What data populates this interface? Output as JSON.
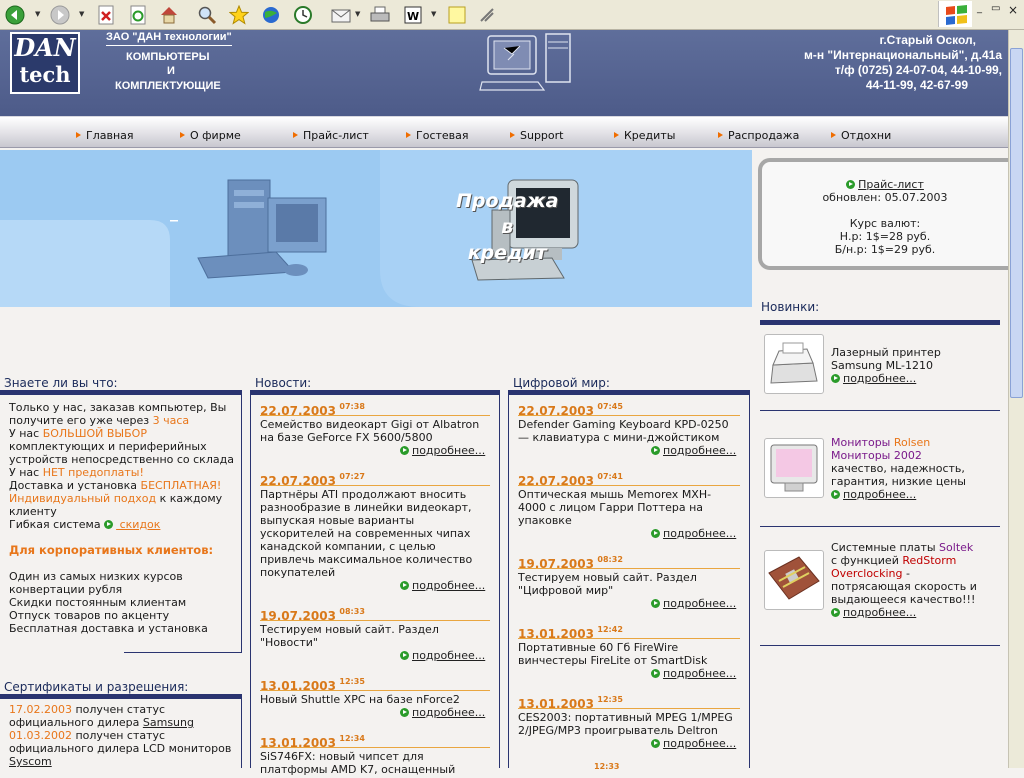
{
  "browser": {
    "toolbar_icons": [
      "back-icon",
      "forward-icon",
      "stop-icon",
      "refresh-icon",
      "home-icon",
      "search-icon",
      "favorites-icon",
      "media-icon",
      "history-icon",
      "mail-icon",
      "print-icon",
      "edit-icon",
      "discuss-icon",
      "messenger-icon"
    ],
    "window_buttons": [
      "_",
      "▭",
      "×"
    ]
  },
  "header": {
    "logo_line1": "DAN",
    "logo_line2": "tech",
    "company": "ЗАО \"ДАН технологии\"",
    "tagline1": "КОМПЬЮТЕРЫ",
    "tagline2": "И",
    "tagline3": "КОМПЛЕКТУЮЩИЕ",
    "addr1": "г.Старый Оскол,",
    "addr2": "м-н \"Интернациональный\", д.41а",
    "addr3": "т/ф  (0725) 24-07-04, 44-10-99,",
    "addr4": "44-11-99, 42-67-99"
  },
  "nav": [
    "Главная",
    "О фирме",
    "Прайс-лист",
    "Гостевая",
    "Support",
    "Кредиты",
    "Распродажа",
    "Отдохни"
  ],
  "banner": {
    "promo1": "Продажа",
    "promo2": "в",
    "promo3": "кредит"
  },
  "pricebox": {
    "link": "Прайс-лист",
    "updated": "обновлен: 05.07.2003",
    "rates_title": "Курс валют:",
    "rate1": "Н.р: 1$=28 руб.",
    "rate2": "Б/н.р: 1$=29 руб."
  },
  "know": {
    "title": "Знаете ли вы что:",
    "l1": "Только у нас, заказав компьютер, Вы",
    "l2a": "получите его уже через ",
    "l2b": "3 часа",
    "l3a": "У нас ",
    "l3b": "БОЛЬШОЙ ВЫБОР",
    "l4": "комплектующих и периферийных",
    "l5": "устройств непосредственно со склада",
    "l6a": "У нас ",
    "l6b": "НЕТ предоплаты!",
    "l7a": "Доставка и установка ",
    "l7b": "БЕСПЛАТНАЯ!",
    "l8a": "Индивидуальный подход",
    "l8b": " к каждому",
    "l9": "клиенту",
    "l10a": "Гибкая система ",
    "l10b": " скидок",
    "corp_title": "Для корпоративных клиентов:",
    "corp": [
      "Один из самых низких курсов",
      "конвертации рубля",
      "Скидки постоянным клиентам",
      "Отпуск товаров по акценту",
      "Бесплатная доставка и установка"
    ]
  },
  "certs": {
    "title": "Сертификаты и разрешения:",
    "c1date": "17.02.2003",
    "c1a": " получен статус",
    "c1b": "официального дилера ",
    "c1c": "Samsung",
    "c2date": "01.03.2002",
    "c2a": " получен статус",
    "c2b": "официального дилера LCD мониторов",
    "c2c": "Syscom"
  },
  "news": {
    "title": "Новости:",
    "more": "подробнее...",
    "items": [
      {
        "date": "22.07.2003",
        "time": "07:38",
        "l1": "Семейство видеокарт Gigi от Albatron",
        "l2": "на базе GeForce FX 5600/5800"
      },
      {
        "date": "22.07.2003",
        "time": "07:27",
        "l1": "Партнёры ATI продолжают вносить",
        "l2": "разнообразие в линейки видеокарт,",
        "l3": "выпуская новые варианты",
        "l4": "ускорителей на современных чипах",
        "l5": "канадской компании, с целью",
        "l6": "привлечь максимальное количество",
        "l7": "покупателей"
      },
      {
        "date": "19.07.2003",
        "time": "08:33",
        "l1": "Тестируем новый сайт. Раздел",
        "l2": "\"Новости\""
      },
      {
        "date": "13.01.2003",
        "time": "12:35",
        "l1": "Новый Shuttle XPC на базе nForce2"
      },
      {
        "date": "13.01.2003",
        "time": "12:34",
        "l1": "SiS746FX: новый чипсет для",
        "l2": "платформы AMD K7, оснащенный"
      }
    ]
  },
  "digital": {
    "title": "Цифровой мир:",
    "more": "подробнее...",
    "items": [
      {
        "date": "22.07.2003",
        "time": "07:45",
        "l1": "Defender Gaming Keyboard KPD-0250",
        "l2": "— клавиатура с мини-джойстиком"
      },
      {
        "date": "22.07.2003",
        "time": "07:41",
        "l1": "Оптическая мышь Memorex MXH-",
        "l2": "4000 с лицом Гарри Поттера на",
        "l3": "упаковке"
      },
      {
        "date": "19.07.2003",
        "time": "08:32",
        "l1": "Тестируем новый сайт. Раздел",
        "l2": "\"Цифровой мир\""
      },
      {
        "date": "13.01.2003",
        "time": "12:42",
        "l1": "Портативные 60 Гб FireWire",
        "l2": "винчестеры FireLite от SmartDisk"
      },
      {
        "date": "13.01.2003",
        "time": "12:35",
        "l1": "CES2003: портативный MPEG 1/MPEG",
        "l2": "2/JPEG/MP3 проигрыватель Deltron"
      },
      {
        "date": "",
        "time": "12:33"
      }
    ]
  },
  "novelties": {
    "title": "Новинки:",
    "more": "подробнее...",
    "p1": {
      "l1": "Лазерный принтер",
      "l2": "Samsung ML-1210"
    },
    "p2": {
      "l1a": "Мониторы ",
      "l1b": "Rolsen",
      "l2": "Мониторы 2002",
      "l3": "качество, надежность,",
      "l4": "гарантия, низкие цены"
    },
    "p3": {
      "l1a": "Системные платы ",
      "l1b": "Soltek",
      "l2a": "с функцией ",
      "l2b": "RedStorm",
      "l3a": "Overclocking",
      "l3b": " -",
      "l4": "потрясающая скорость и",
      "l5": "выдающееся качество!!!"
    }
  },
  "colors": {
    "accent": "#e8761a",
    "header": "#56648f",
    "nav_bar": "#2a3470",
    "banner": "#9ccaf2",
    "purple": "#7a1a8a",
    "red": "#c00000"
  }
}
